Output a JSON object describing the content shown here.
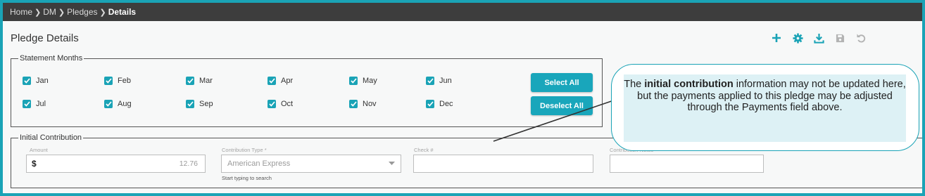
{
  "breadcrumb": {
    "items": [
      "Home",
      "DM",
      "Pledges"
    ],
    "current": "Details"
  },
  "page": {
    "title": "Pledge Details"
  },
  "toolbar": {
    "icons": [
      "add-icon",
      "gear-icon",
      "download-icon",
      "save-icon",
      "undo-icon"
    ]
  },
  "statement_months": {
    "legend": "Statement Months",
    "months": [
      "Jan",
      "Feb",
      "Mar",
      "Apr",
      "May",
      "Jun",
      "Jul",
      "Aug",
      "Sep",
      "Oct",
      "Nov",
      "Dec"
    ],
    "all_checked": true,
    "select_all_label": "Select All",
    "deselect_all_label": "Deselect All"
  },
  "initial_contribution": {
    "legend": "Initial Contribution",
    "amount_label": "Amount",
    "amount_prefix": "$",
    "amount_value": "12.76",
    "type_label": "Contribution Type *",
    "type_value": "American Express",
    "type_hint": "Start typing to search",
    "check_label": "Check #",
    "check_value": "",
    "notes_label": "Contribution Notes",
    "notes_value": ""
  },
  "callout": {
    "pre": "The ",
    "bold": "initial contribution",
    "post": " information may not be updated here, but the payments applied to this pledge may be adjusted through the Payments field above."
  },
  "colors": {
    "accent": "#1aa3b6",
    "topbar": "#3d3d3d"
  }
}
